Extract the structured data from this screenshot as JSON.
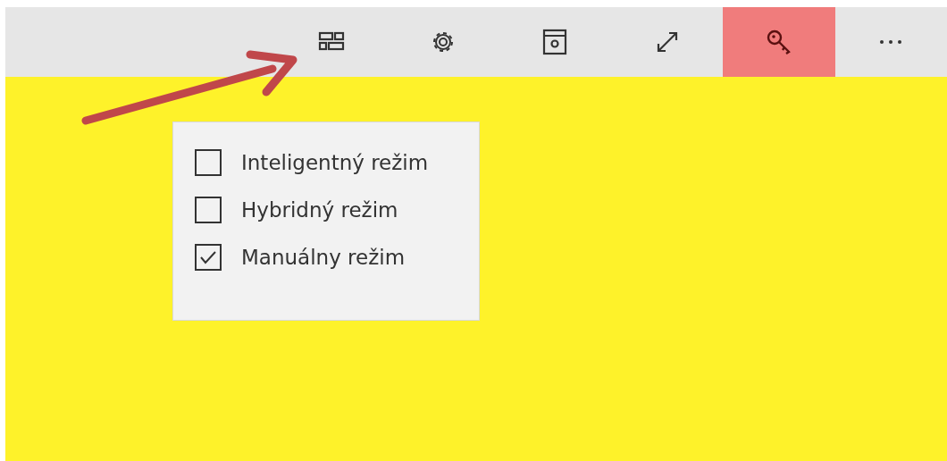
{
  "toolbar": {
    "buttons": [
      {
        "kind": "layout",
        "selected": false
      },
      {
        "kind": "settings",
        "selected": false
      },
      {
        "kind": "window-gear",
        "selected": false
      },
      {
        "kind": "resize",
        "selected": false
      },
      {
        "kind": "key",
        "selected": true
      },
      {
        "kind": "more",
        "selected": false
      }
    ]
  },
  "menu": {
    "items": [
      {
        "label": "Inteligentný režim",
        "checked": false
      },
      {
        "label": "Hybridný režim",
        "checked": false
      },
      {
        "label": "Manuálny režim",
        "checked": true
      }
    ]
  }
}
